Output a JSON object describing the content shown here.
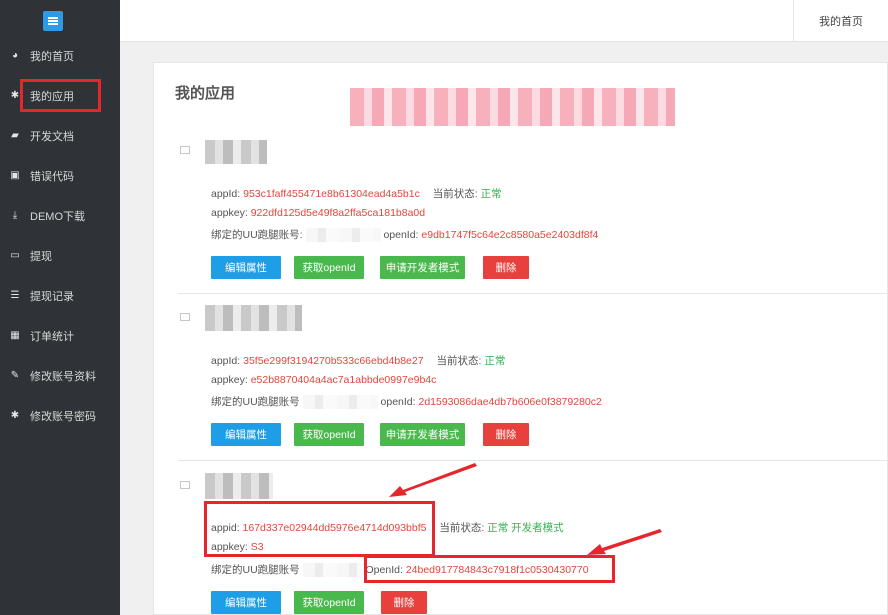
{
  "sidebar": {
    "items": [
      {
        "icon": "dashboard-icon",
        "label": "我的首页"
      },
      {
        "icon": "gear-icon",
        "label": "我的应用"
      },
      {
        "icon": "book-icon",
        "label": "开发文档"
      },
      {
        "icon": "error-code-icon",
        "label": "错误代码"
      },
      {
        "icon": "download-icon",
        "label": "DEMO下载"
      },
      {
        "icon": "card-icon",
        "label": "提现"
      },
      {
        "icon": "list-icon",
        "label": "提现记录"
      },
      {
        "icon": "grid-icon",
        "label": "订单统计"
      },
      {
        "icon": "pencil-icon",
        "label": "修改账号资料"
      },
      {
        "icon": "gear-icon",
        "label": "修改账号密码"
      }
    ]
  },
  "header": {
    "home_link": "我的首页"
  },
  "main": {
    "title": "我的应用",
    "labels": {
      "appid": "appId:",
      "appid_lower": "appid:",
      "appkey": "appkey:",
      "status": "当前状态:",
      "bound_account": "绑定的UU跑腿账号:",
      "bound_account_nocolon": "绑定的UU跑腿账号",
      "openid": "openId:",
      "openid_cap": "OpenId:"
    },
    "apps": [
      {
        "appid": "953c1faff455471e8b61304ead4a5b1c",
        "status": "正常",
        "appkey": "922dfd125d5e49f8a2ffa5ca181b8a0d",
        "openid": "e9db1747f5c64e2c8580a5e2403df8f4"
      },
      {
        "appid": "35f5e299f3194270b533c66ebd4b8e27",
        "status": "正常",
        "appkey": "e52b8870404a4ac7a1abbde0997e9b4c",
        "openid": "2d1593086dae4db7b606e0f3879280c2"
      },
      {
        "appid": "167d337e02944dd5976e4714d093bbf5",
        "status": "正常",
        "status_extra": "开发者模式",
        "appkey": "S3",
        "openid": "24bed917784843c7918f1c0530430770"
      }
    ],
    "buttons": {
      "edit": "编辑属性",
      "get_openid": "获取openId",
      "dev_mode": "申请开发者模式",
      "delete": "删除"
    }
  },
  "colors": {
    "sidebar_bg": "#2f3337",
    "accent_blue": "#1f9ee8",
    "accent_green": "#4ab94d",
    "accent_red": "#e8403c",
    "highlight_red": "#e5262d"
  }
}
